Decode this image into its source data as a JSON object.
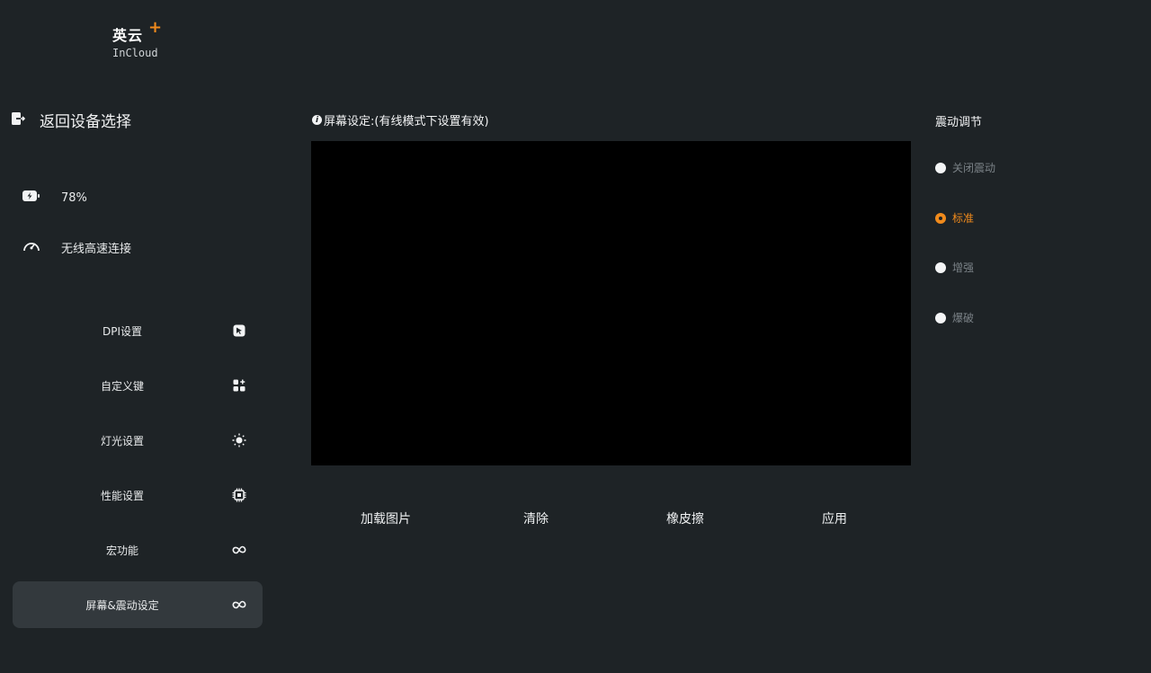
{
  "app": {
    "name": "英云",
    "name_en": "InCloud",
    "accent": "#f08a1c"
  },
  "sidebar": {
    "back": {
      "label": "返回设备选择",
      "icon": "exit-icon"
    },
    "battery": {
      "value": "78%",
      "icon": "battery-icon"
    },
    "connection": {
      "value": "无线高速连接",
      "icon": "speedometer-icon"
    },
    "menu": [
      {
        "label": "DPI设置",
        "icon": "cursor-icon"
      },
      {
        "label": "自定义键",
        "icon": "grid-plus-icon"
      },
      {
        "label": "灯光设置",
        "icon": "sun-icon"
      },
      {
        "label": "性能设置",
        "icon": "chip-icon"
      },
      {
        "label": "宏功能",
        "icon": "infinity-icon"
      },
      {
        "label": "屏幕&震动设定",
        "icon": "infinity-icon",
        "active": true
      }
    ]
  },
  "main": {
    "title": "屏幕设定:(有线模式下设置有效)",
    "actions": {
      "load": "加载图片",
      "clear": "清除",
      "eraser": "橡皮擦",
      "apply": "应用"
    }
  },
  "vibration": {
    "title": "震动调节",
    "options": [
      {
        "label": "关闭震动",
        "selected": false
      },
      {
        "label": "标准",
        "selected": true
      },
      {
        "label": "增强",
        "selected": false
      },
      {
        "label": "爆破",
        "selected": false
      }
    ]
  }
}
